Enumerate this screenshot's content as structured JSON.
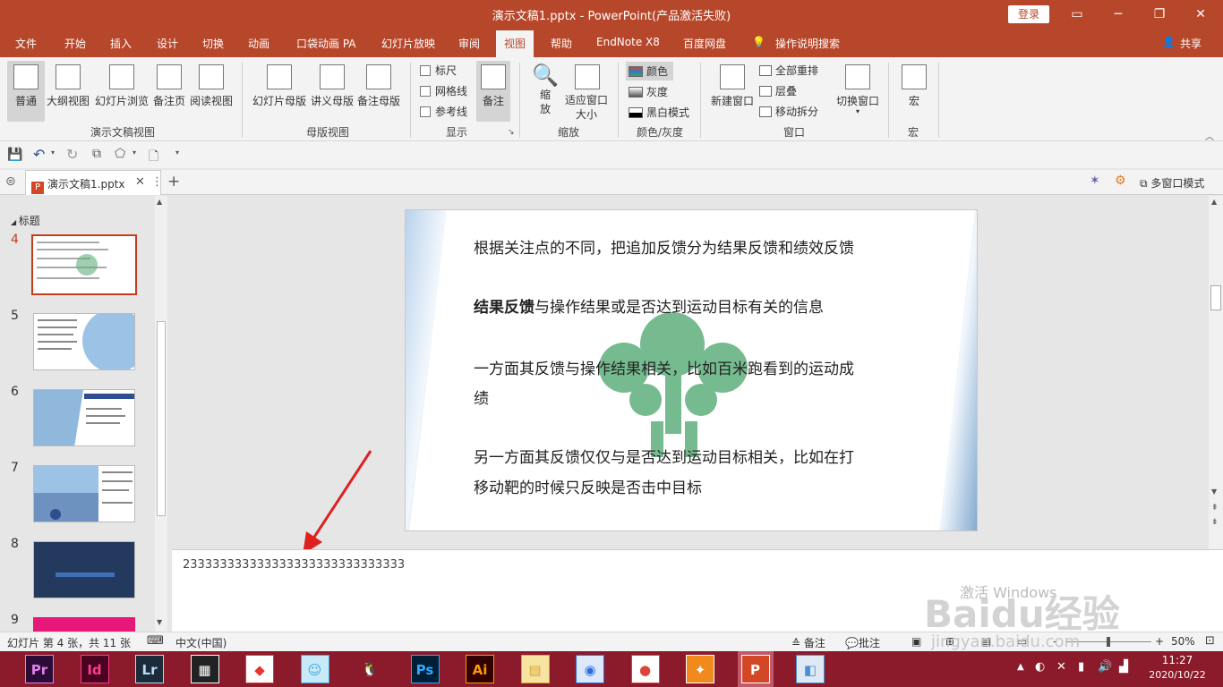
{
  "titlebar": {
    "title": "演示文稿1.pptx  -  PowerPoint(产品激活失败)",
    "login": "登录",
    "restore_icon": "ribbon-display-icon",
    "controls": [
      "─",
      "❐",
      "✕"
    ]
  },
  "tabs": [
    "文件",
    "开始",
    "插入",
    "设计",
    "切换",
    "动画",
    "口袋动画 PA",
    "幻灯片放映",
    "审阅",
    "视图",
    "帮助",
    "EndNote X8",
    "百度网盘",
    "操作说明搜索"
  ],
  "share": "共享",
  "ribbon": {
    "views": {
      "normal": "普通",
      "outline": "大纲视图",
      "sorter": "幻灯片浏览",
      "notes_page": "备注页",
      "reading": "阅读视图",
      "group": "演示文稿视图"
    },
    "master": {
      "slide_master": "幻灯片母版",
      "handout_master": "讲义母版",
      "notes_master": "备注母版",
      "group": "母版视图"
    },
    "show": {
      "ruler": "标尺",
      "gridlines": "网格线",
      "guides": "参考线",
      "notes": "备注",
      "group": "显示"
    },
    "zoom": {
      "zoom": "缩放",
      "fit": "适应窗口大小",
      "group": "缩放"
    },
    "color": {
      "color": "颜色",
      "gray": "灰度",
      "bw": "黑白模式",
      "group": "颜色/灰度"
    },
    "window": {
      "new": "新建窗口",
      "arrange": "全部重排",
      "cascade": "层叠",
      "move_split": "移动拆分",
      "switch": "切换窗口",
      "group": "窗口"
    },
    "macros": {
      "macro": "宏",
      "group": "宏"
    }
  },
  "doc_tab": {
    "name": "演示文稿1.pptx",
    "multi_window": "多窗口模式"
  },
  "sections": {
    "title": "标题"
  },
  "thumbnails": [
    {
      "num": "4",
      "active": true
    },
    {
      "num": "5",
      "active": false
    },
    {
      "num": "6",
      "active": false
    },
    {
      "num": "7",
      "active": false
    },
    {
      "num": "8",
      "active": false
    },
    {
      "num": "9",
      "active": false
    }
  ],
  "slide": {
    "line1": "根据关注点的不同，把追加反馈分为结果反馈和绩效反馈",
    "line2_bold": "结果反馈",
    "line2_rest": "与操作结果或是否达到运动目标有关的信息",
    "line3a": "一方面其反馈与操作结果相关，比如百米跑看到的运动成",
    "line3b": "绩",
    "line4a": "另一方面其反馈仅仅与是否达到运动目标相关，比如在打",
    "line4b": "移动靶的时候只反映是否击中目标"
  },
  "notes_text": "233333333333333333333333333333",
  "status": {
    "slide_info": "幻灯片 第 4 张，共 11 张",
    "language": "中文(中国)",
    "notes": "备注",
    "comments": "批注",
    "zoom": "50%",
    "zoom_minus": "-",
    "zoom_plus": "+"
  },
  "watermark": {
    "activate": "激活 Windows",
    "baidu": "Baidu经验",
    "url": "jingyan.baidu.com"
  },
  "taskbar": {
    "apps": [
      {
        "label": "Pr",
        "color": "#e27fe8",
        "bg": "#2a0c37"
      },
      {
        "label": "Id",
        "color": "#ff3c8e",
        "bg": "#49021f"
      },
      {
        "label": "Lr",
        "color": "#b6dcf5",
        "bg": "#1b2b3a"
      },
      {
        "label": "▦",
        "color": "#ffffff",
        "bg": "#222222"
      },
      {
        "label": "◆",
        "color": "#e9352f",
        "bg": "#ffffff"
      },
      {
        "label": "☺",
        "color": "#3aa6dd",
        "bg": "#c8e9f7"
      },
      {
        "label": "🐧",
        "color": "#000000",
        "bg": "transparent"
      },
      {
        "label": "Ps",
        "color": "#31a8ff",
        "bg": "#001e36"
      },
      {
        "label": "Ai",
        "color": "#ff9a00",
        "bg": "#330000"
      },
      {
        "label": "▤",
        "color": "#d9a53b",
        "bg": "#f7e4a1"
      },
      {
        "label": "◉",
        "color": "#2d6cdf",
        "bg": "#dde9fb"
      },
      {
        "label": "●",
        "color": "#db4437",
        "bg": "#ffffff"
      },
      {
        "label": "✦",
        "color": "#ffffff",
        "bg": "#f08a1c"
      },
      {
        "label": "P",
        "color": "#ffffff",
        "bg": "#d24726"
      },
      {
        "label": "◧",
        "color": "#4a8fd4",
        "bg": "#dfe9f3"
      }
    ],
    "time": "11:27",
    "date": "2020/10/22"
  },
  "colors": {
    "accent": "#b7472a",
    "thumb_active": "#c43e1c",
    "logo_green": "#5fae7d",
    "taskbar": "#8b1a2a"
  }
}
